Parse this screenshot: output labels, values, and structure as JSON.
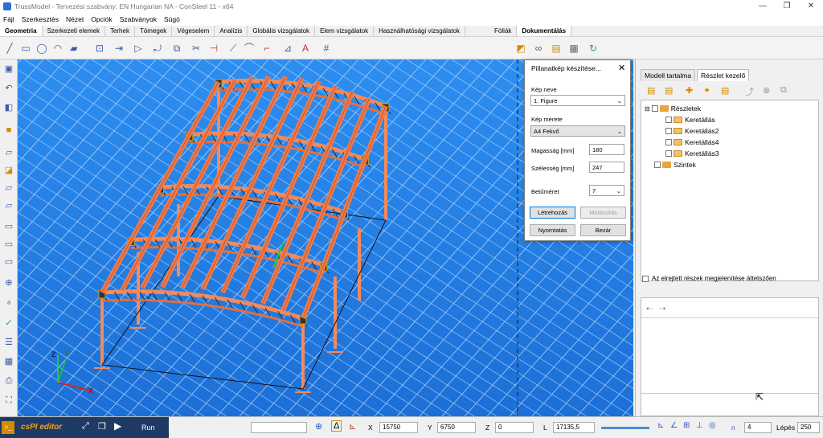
{
  "window": {
    "title": "TrussModel - Tervezési szabvány: EN Hungarian NA - ConSteel 11 - x64",
    "minimize": "—",
    "restore": "❐",
    "close": "✕"
  },
  "menu": [
    "Fájl",
    "Szerkesztés",
    "Nézet",
    "Opciók",
    "Szabványok",
    "Súgó"
  ],
  "ribbon": {
    "tabs": [
      "Geometria",
      "Szerkezeti elemek",
      "Terhek",
      "Tömegek",
      "Végeselem",
      "Analízis",
      "Globális vizsgálatok",
      "Elem vizsgálatok",
      "Használhatósági vizsgálatok"
    ],
    "right_tabs": [
      "Fóliák",
      "Dokumentálás"
    ]
  },
  "dialog": {
    "title": "Pillanatkép készítése...",
    "name_label": "Kép neve",
    "name_value": "1. Figure",
    "size_label": "Kép mérete",
    "size_value": "A4 Fekvő",
    "height_label": "Magasság [mm]",
    "height_value": "180",
    "width_label": "Szélesség [mm]",
    "width_value": "247",
    "font_label": "Betűméret",
    "font_value": "7",
    "create": "Létrehozás",
    "modify": "Módosítás",
    "print": "Nyomtatás",
    "close": "Bezár"
  },
  "right_panel": {
    "tabs": [
      "Modell tartalma",
      "Részlet kezelő"
    ],
    "tree": {
      "root": "Részletek",
      "children": [
        "Keretállás",
        "Keretállás2",
        "Keretállás4",
        "Keretállás3"
      ],
      "levels": "Szintek"
    },
    "transparency_label": "Az elrejtett részek megjelenítése áttetszően"
  },
  "status": {
    "cspi": "csPI editor",
    "run": "Run",
    "x_label": "X",
    "x_value": "15750",
    "y_label": "Y",
    "y_value": "6750",
    "z_label": "Z",
    "z_value": "0",
    "l_label": "L",
    "l_value": "17135,5",
    "n_label": "n",
    "n_value": "4",
    "step_label": "Lépés",
    "step_value": "250"
  },
  "axes": {
    "x": "X",
    "y": "Y",
    "z": "Z"
  },
  "colors": {
    "viewport_top": "#2a84e8",
    "viewport_bottom": "#1f74dc",
    "beam": "#f07a4a",
    "dialog_accent": "#0078d7"
  }
}
